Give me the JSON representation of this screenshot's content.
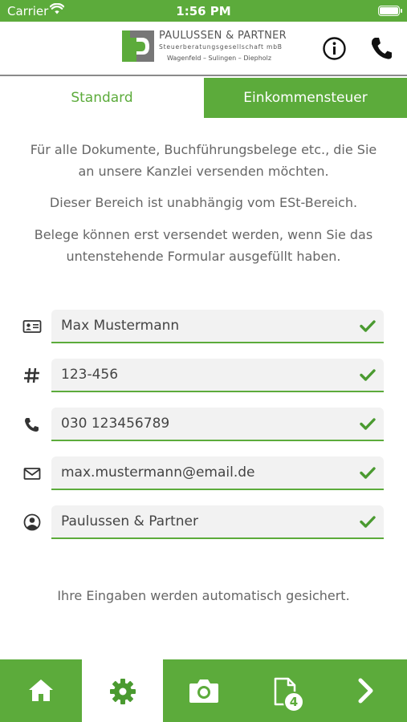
{
  "status_bar": {
    "carrier": "Carrier",
    "time": "1:56 PM"
  },
  "header": {
    "logo_title": "PAULUSSEN & PARTNER",
    "logo_subtitle": "Steuerberatungsgesellschaft mbB",
    "logo_places": "Wagenfeld – Sulingen – Diepholz"
  },
  "tabs": [
    {
      "label": "Standard",
      "active": true
    },
    {
      "label": "Einkommensteuer",
      "active": false
    }
  ],
  "intro": {
    "line1": "Für alle Dokumente, Buchführungsbelege etc., die Sie",
    "line2": "an unsere Kanzlei versenden möchten.",
    "line3": "Dieser Bereich ist unabhängig vom ESt-Bereich.",
    "line4": "Belege können erst versendet werden, wenn Sie das",
    "line5": "untenstehende Formular ausgefüllt haben."
  },
  "form": {
    "name": "Max Mustermann",
    "client_number": "123-456",
    "phone": "030 123456789",
    "email": "max.mustermann@email.de",
    "advisor": "Paulussen & Partner"
  },
  "autosave_note": "Ihre Eingaben werden automatisch gesichert.",
  "bottom_nav": {
    "items": [
      "home-icon",
      "settings-icon",
      "camera-icon",
      "document-icon",
      "next-icon"
    ],
    "active": "settings-icon",
    "document_badge": "4"
  },
  "colors": {
    "accent": "#5cab3b",
    "text": "#666666",
    "field_bg": "#f2f2f2"
  }
}
